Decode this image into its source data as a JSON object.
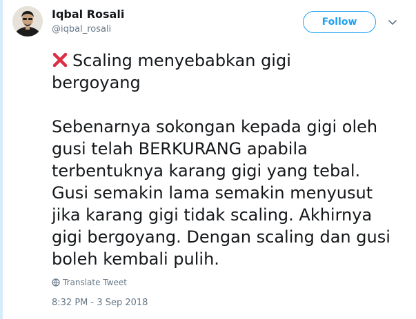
{
  "author": {
    "name": "Iqbal Rosali",
    "handle": "@iqbal_rosali"
  },
  "actions": {
    "follow_label": "Follow",
    "menu_icon": "chevron-down-icon"
  },
  "tweet": {
    "emoji_icon": "cross-mark-icon",
    "title_text": "Scaling menyebabkan gigi\nbergoyang",
    "body_text": "Sebenarnya sokongan kepada gigi oleh\ngusi telah BERKURANG apabila\nterbentuknya karang gigi yang tebal.\nGusi semakin lama semakin menyusut\njika karang gigi tidak scaling. Akhirnya\ngigi bergoyang. Dengan scaling dan gusi\nboleh kembali pulih.",
    "translate_label": "Translate Tweet",
    "timestamp": "8:32 PM - 3 Sep 2018"
  },
  "colors": {
    "accent": "#1da1f2",
    "secondary_text": "#657786",
    "primary_text": "#14171a",
    "cross": "#dd2e44"
  }
}
